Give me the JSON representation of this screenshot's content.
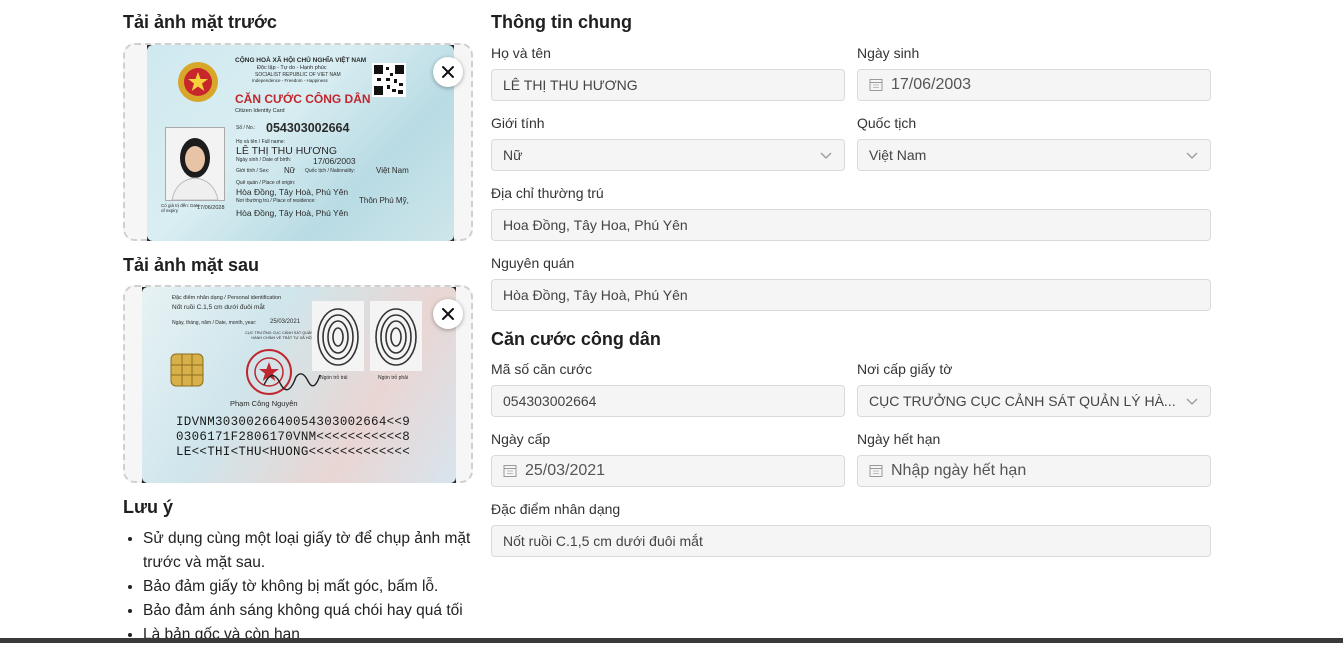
{
  "front": {
    "title": "Tải ảnh mặt trước",
    "card": {
      "country": "CỘNG HOÀ XÃ HỘI CHỦ NGHĨA VIỆT NAM",
      "motto": "Độc lập - Tự do - Hạnh phúc",
      "country_en": "SOCIALIST REPUBLIC OF VIET NAM",
      "motto_en": "Independence - Freedom - Happiness",
      "heading": "CĂN CƯỚC CÔNG DÂN",
      "heading_en": "Citizen Identity Card",
      "no_label": "Số / No.:",
      "number": "054303002664",
      "name_label": "Họ và tên / Full name:",
      "name": "LÊ THỊ THU HƯƠNG",
      "dob_label": "Ngày sinh / Date of birth:",
      "dob": "17/06/2003",
      "sex_label": "Giới tính / Sex:",
      "sex": "Nữ",
      "nat_label": "Quốc tịch / Nationality:",
      "nat": "Việt Nam",
      "origin_label": "Quê quán / Place of origin:",
      "origin": "Hòa Đồng, Tây Hoà, Phú Yên",
      "residence_label": "Nơi thường trú / Place of residence:",
      "residence_1": "Thôn Phú Mỹ,",
      "residence_2": "Hòa Đồng, Tây Hoà, Phú Yên",
      "expiry_label": "Có giá trị đến: Date of expiry",
      "expiry": "17/06/2028"
    }
  },
  "back": {
    "title": "Tải ảnh mặt sau",
    "card": {
      "features_label": "Đặc điểm nhân dạng / Personal identification",
      "features": "Nốt ruồi C.1,5 cm dưới đuôi mắt",
      "date_label": "Ngày, tháng, năm / Date, month, year:",
      "date": "25/03/2021",
      "issuer": "CỤC TRƯỞNG CỤC CẢNH SÁT QUẢN LÝ HÀNH CHÍNH VỀ TRẬT TỰ XÃ HỘI",
      "left_index": "Ngón trỏ trái",
      "right_index": "Ngón trỏ phải",
      "signer": "Phạm Công Nguyên",
      "mrz_1": "IDVNM3030026640054303002664<<9",
      "mrz_2": "0306171F2806170VNM<<<<<<<<<<<8",
      "mrz_3": "LE<<THI<THU<HUONG<<<<<<<<<<<<<"
    }
  },
  "notes": {
    "title": "Lưu ý",
    "items": [
      "Sử dụng cùng một loại giấy tờ để chụp ảnh mặt trước và mặt sau.",
      "Bảo đảm giấy tờ không bị mất góc, bấm lỗ.",
      "Bảo đảm ánh sáng không quá chói hay quá tối",
      "Là bản gốc và còn hạn"
    ]
  },
  "general": {
    "title": "Thông tin chung",
    "full_name": {
      "label": "Họ và tên",
      "value": "LÊ THỊ THU HƯƠNG"
    },
    "birth_date": {
      "label": "Ngày sinh",
      "value": "17/06/2003"
    },
    "gender": {
      "label": "Giới tính",
      "value": "Nữ"
    },
    "nationality": {
      "label": "Quốc tịch",
      "value": "Việt Nam"
    },
    "permanent_address": {
      "label": "Địa chỉ thường trú",
      "value": "Hoa Đồng, Tây Hoa, Phú Yên"
    },
    "hometown": {
      "label": "Nguyên quán",
      "value": "Hòa Đồng, Tây Hoà, Phú Yên"
    }
  },
  "id_card": {
    "title": "Căn cước công dân",
    "id_number": {
      "label": "Mã số căn cước",
      "value": "054303002664"
    },
    "issued_by": {
      "label": "Nơi cấp giấy tờ",
      "value": "CỤC TRƯỞNG CỤC CẢNH SÁT QUẢN LÝ HÀ..."
    },
    "issue_date": {
      "label": "Ngày cấp",
      "value": "25/03/2021"
    },
    "expiry_date": {
      "label": "Ngày hết hạn",
      "placeholder": "Nhập ngày hết hạn"
    },
    "features": {
      "label": "Đặc điểm nhân dạng",
      "value": "Nốt ruồi C.1,5 cm dưới đuôi mắt"
    }
  },
  "icons": {
    "close": "close-icon",
    "calendar": "calendar-icon",
    "dropdown": "chevron-down-icon"
  },
  "colors": {
    "field_bg": "#f5f5f5",
    "field_border": "#d9d9d9",
    "card_red": "#c0262d"
  }
}
